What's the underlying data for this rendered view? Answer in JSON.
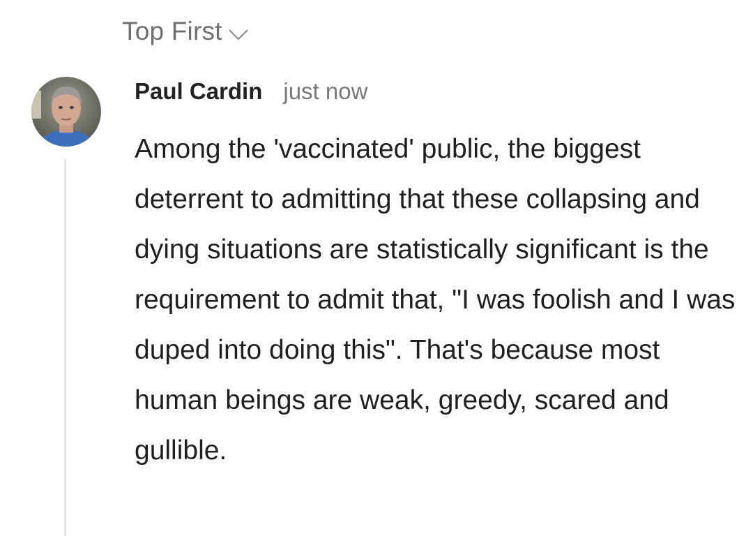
{
  "sort": {
    "label": "Top First",
    "icon": "chevron-down-icon"
  },
  "comment": {
    "author": "Paul Cardin",
    "timestamp": "just now",
    "body": "Among the 'vaccinated' public, the biggest deterrent to admitting that these collapsing and dying situations are statistically significant is the requirement to admit that, \"I was foolish and I was duped into doing this\". That's because most human beings are weak, greedy, scared and gullible."
  },
  "colors": {
    "sort_text": "#6f6f6f",
    "author_text": "#222222",
    "timestamp_text": "#777777",
    "body_text": "#1f1f1f",
    "thread_line": "#e3e5ea"
  }
}
